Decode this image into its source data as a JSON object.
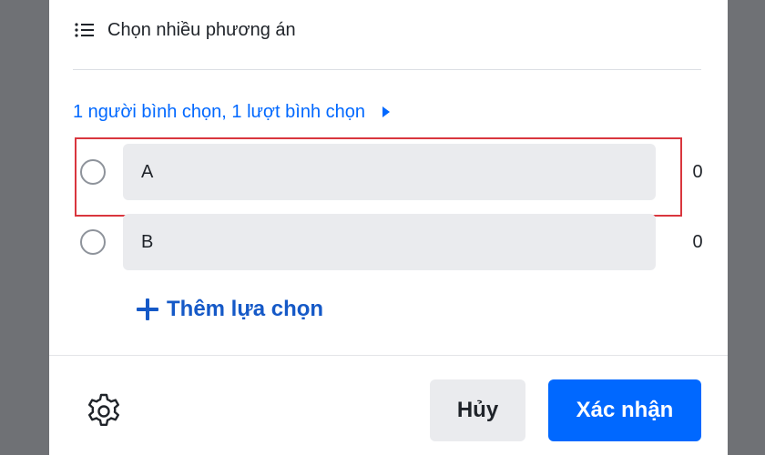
{
  "poll": {
    "mode_label": "Chọn nhiều phương án",
    "voters_summary": "1 người bình chọn, 1 lượt bình chọn",
    "options": [
      {
        "label": "A",
        "count": "0"
      },
      {
        "label": "B",
        "count": "0"
      }
    ],
    "add_option_label": "Thêm lựa chọn"
  },
  "footer": {
    "cancel_label": "Hủy",
    "confirm_label": "Xác nhận"
  },
  "icons": {
    "mode": "list-icon",
    "voters": "caret-right-icon",
    "add": "plus-icon",
    "settings": "gear-icon"
  },
  "colors": {
    "accent": "#0068ff",
    "add_option": "#1559c7",
    "highlight": "#d9363e",
    "option_fill": "#eaebee",
    "backdrop": "#6f7175"
  }
}
